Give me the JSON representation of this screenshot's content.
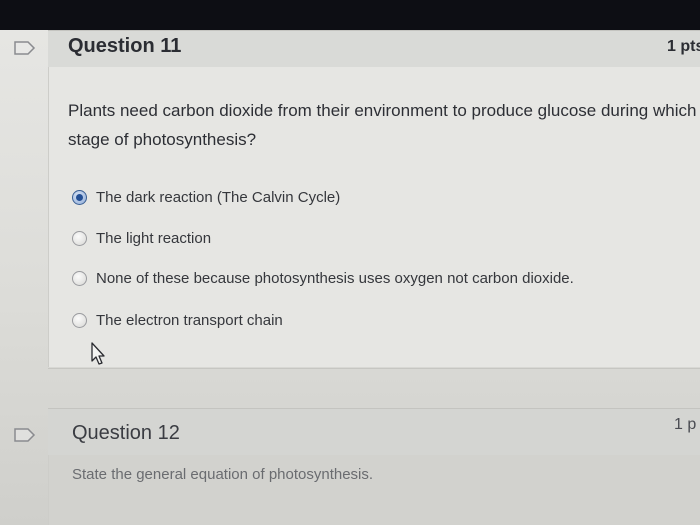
{
  "question_11": {
    "title": "Question 11",
    "points": "1 pts",
    "text": "Plants need carbon dioxide from their environment to produce glucose during which stage of photosynthesis?",
    "answers": [
      {
        "label": "The dark reaction (The Calvin Cycle)",
        "selected": true
      },
      {
        "label": "The light reaction",
        "selected": false
      },
      {
        "label": "None of these because photosynthesis uses oxygen not carbon dioxide.",
        "selected": false
      },
      {
        "label": "The electron transport chain",
        "selected": false
      }
    ]
  },
  "question_12": {
    "title": "Question 12",
    "points": "1 p",
    "text": "State the general equation of photosynthesis."
  },
  "icons": {
    "flag": "flag-icon",
    "cursor": "pointer-cursor-icon"
  },
  "colors": {
    "selected_radio": "#234f95",
    "flag_outline": "#8a8b8f"
  }
}
